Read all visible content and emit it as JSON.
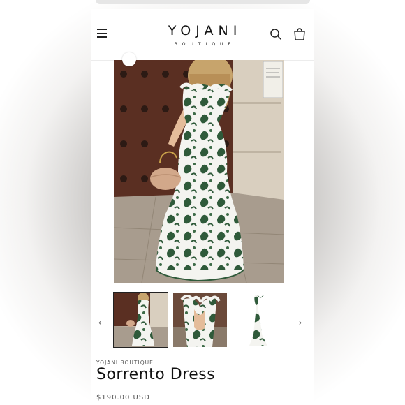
{
  "store": {
    "name": "YOJANI",
    "tagline": "BOUTIQUE"
  },
  "header_icons": {
    "menu": "menu-icon",
    "search": "search-icon",
    "cart": "cart-icon"
  },
  "gallery": {
    "main_image": "Model in green and white paisley mermaid maxi dress with ruffled straps holding a tan handbag",
    "thumbnails": [
      {
        "alt": "Full length dress front view"
      },
      {
        "alt": "Back view with ruffles"
      },
      {
        "alt": "Dress on white background"
      }
    ],
    "prev_icon": "chevron-left-icon",
    "next_icon": "chevron-right-icon"
  },
  "product": {
    "vendor": "YOJANI BOUTIQUE",
    "title": "Sorrento Dress",
    "price": "$190.00 USD"
  },
  "colors": {
    "accent": "#2f5a3a",
    "text": "#111111"
  }
}
